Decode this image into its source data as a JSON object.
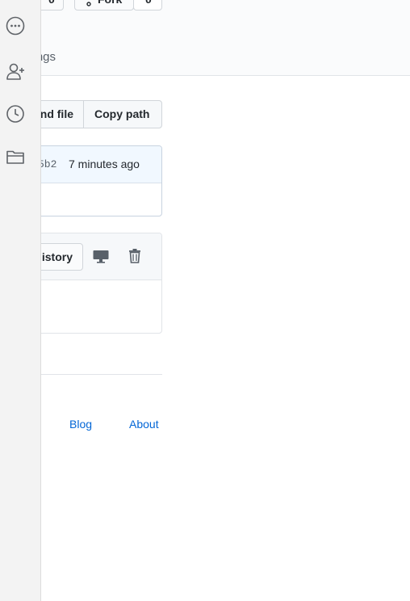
{
  "header": {
    "star_count": "0",
    "fork_label": "Fork",
    "fork_count": "0",
    "tab_fragment": "ngs"
  },
  "file_actions": {
    "find_file_label": "Find file",
    "copy_path_label": "Copy path"
  },
  "commit": {
    "sha_fragment": "5b2",
    "time_ago": "7 minutes ago"
  },
  "file_toolbar": {
    "history_label": "History"
  },
  "footer": {
    "links": [
      "Blog",
      "About"
    ]
  },
  "colors": {
    "link": "#0366d6",
    "commit_bar": "#f1f8ff",
    "sidebar_bg": "#f3f3f3"
  },
  "sidebar": {
    "icons": [
      "more-options-icon",
      "add-user-icon",
      "history-clock-icon",
      "folder-icon"
    ]
  }
}
